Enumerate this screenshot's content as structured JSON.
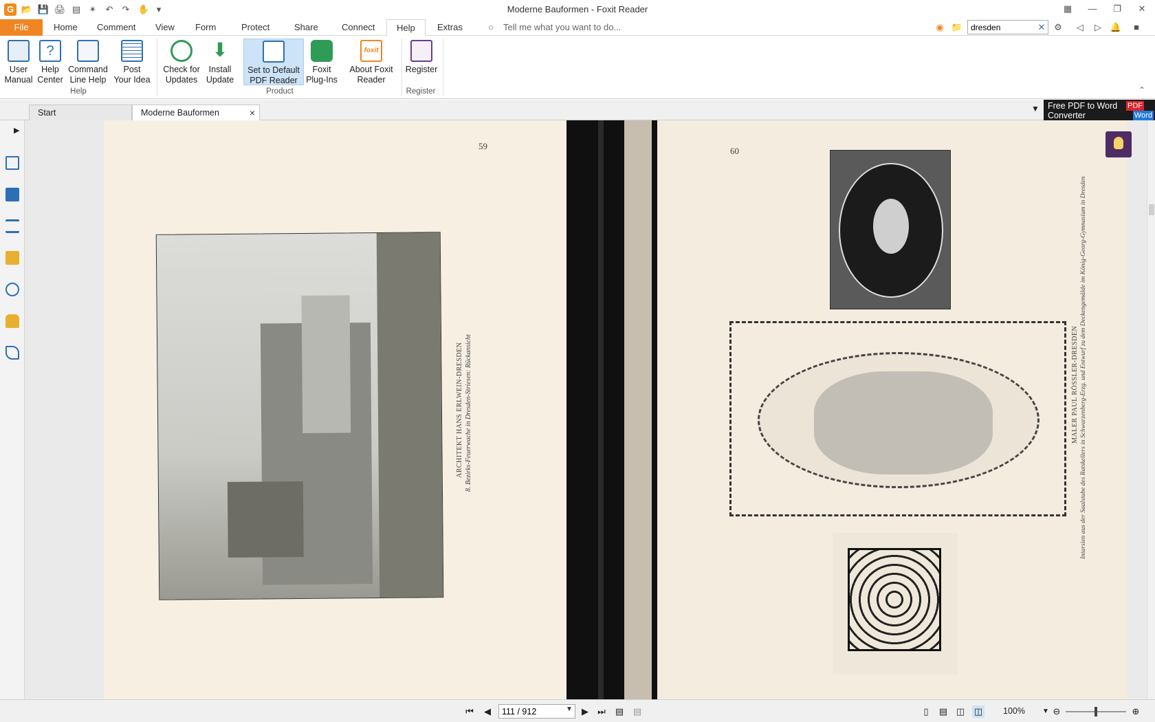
{
  "window": {
    "title": "Moderne Bauformen - Foxit Reader",
    "app_icon": "G"
  },
  "ribbon_tabs": [
    "File",
    "Home",
    "Comment",
    "View",
    "Form",
    "Protect",
    "Share",
    "Connect",
    "Help",
    "Extras"
  ],
  "active_tab": "Help",
  "tell_me": "Tell me what you want to do...",
  "search": {
    "value": "dresden"
  },
  "ribbon": {
    "groups": [
      {
        "label": "Help",
        "buttons": [
          "User Manual",
          "Help Center",
          "Command Line Help",
          "Post Your Idea"
        ]
      },
      {
        "label": "Product",
        "buttons": [
          "Check for Updates",
          "Install Update",
          "Set to Default PDF Reader",
          "Foxit Plug-Ins",
          "About Foxit Reader"
        ]
      },
      {
        "label": "Register",
        "buttons": [
          "Register"
        ]
      }
    ],
    "b1a": "User",
    "b1b": "Manual",
    "b2a": "Help",
    "b2b": "Center",
    "b3a": "Command",
    "b3b": "Line Help",
    "b4a": "Post",
    "b4b": "Your Idea",
    "b5a": "Check for",
    "b5b": "Updates",
    "b6a": "Install",
    "b6b": "Update",
    "b7a": "Set to Default",
    "b7b": "PDF Reader",
    "b8a": "Foxit",
    "b8b": "Plug-Ins",
    "b9a": "About Foxit",
    "b9b": "Reader",
    "b10a": "Register",
    "g1": "Help",
    "g2": "Product",
    "g3": "Register",
    "icon_colors": {
      "blue": "#2d6fb7",
      "green": "#2f9b57",
      "orange": "#f08524",
      "purple": "#6b3d8a"
    }
  },
  "doc_tabs": {
    "start": "Start",
    "current": "Moderne Bauformen"
  },
  "promo": {
    "line1": "Free PDF to Word",
    "line2": "Converter",
    "pdf": "PDF",
    "word": "Word"
  },
  "pages": {
    "left_number": "59",
    "right_number": "60",
    "left_caption_1": "ARCHITEKT HANS ERLWEIN-DRESDEN",
    "left_caption_2": "8. Bezirks-Feuerwache in Dresden-Striesen: Rückansicht",
    "right_caption_1": "MALER PAUL RÖSSLER-DRESDEN",
    "right_caption_2": "Intarsien aus der Saalstube des Ratskellers in Schwarzenberg-Erzg. und Entwurf zu dem Deckengemälde im König-Georg-Gymnasium in Dresden"
  },
  "status": {
    "page_value": "111 / 912",
    "zoom": "100%"
  },
  "accent": "#f08524"
}
